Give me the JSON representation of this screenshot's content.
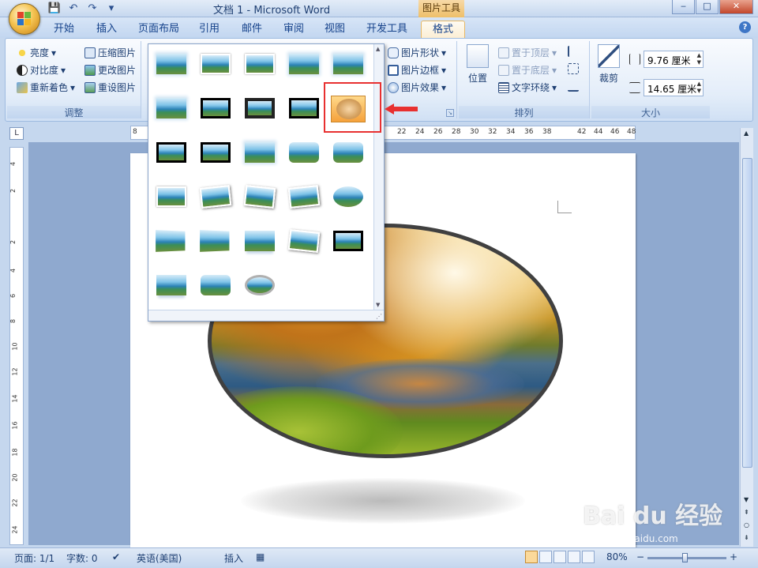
{
  "window": {
    "title": "文档 1 - Microsoft Word",
    "context_tab_group": "图片工具",
    "minimize": "‒",
    "maximize": "□",
    "close": "✕"
  },
  "tabs": [
    {
      "label": "开始"
    },
    {
      "label": "插入"
    },
    {
      "label": "页面布局"
    },
    {
      "label": "引用"
    },
    {
      "label": "邮件"
    },
    {
      "label": "审阅"
    },
    {
      "label": "视图"
    },
    {
      "label": "开发工具"
    },
    {
      "label": "格式",
      "active": true
    }
  ],
  "ribbon": {
    "adjust": {
      "label": "调整",
      "brightness": "亮度",
      "contrast": "对比度",
      "recolor": "重新着色",
      "compress": "压缩图片",
      "change": "更改图片",
      "reset": "重设图片"
    },
    "styles": {
      "shape": "图片形状",
      "border": "图片边框",
      "effects": "图片效果"
    },
    "arrange": {
      "label": "排列",
      "position": "位置",
      "bring_front": "置于顶层",
      "send_back": "置于底层",
      "text_wrap": "文字环绕"
    },
    "size": {
      "label": "大小",
      "crop": "裁剪",
      "height": "9.76 厘米",
      "width": "14.65 厘米"
    }
  },
  "ruler": {
    "h_ticks": [
      "8",
      "22",
      "24",
      "26",
      "28",
      "30",
      "32",
      "34",
      "36",
      "38",
      "42",
      "44",
      "46",
      "48"
    ],
    "v_ticks": [
      "4",
      "2",
      "2",
      "4",
      "6",
      "8",
      "10",
      "12",
      "14",
      "16",
      "18",
      "20",
      "22",
      "24"
    ],
    "corner": "L"
  },
  "gallery": {
    "selected_index": 9,
    "scroll_up": "▲",
    "scroll_down": "▼",
    "grip": "⋰"
  },
  "statusbar": {
    "page": "页面: 1/1",
    "words": "字数: 0",
    "language": "英语(美国)",
    "mode": "插入",
    "zoom": "80%",
    "zoom_out": "−",
    "zoom_in": "+"
  },
  "watermark": {
    "main": "Bai du 经验",
    "sub": "jingyan.baidu.com"
  },
  "colors": {
    "accent": "#15428b",
    "highlight": "#e83030",
    "active_tab": "#fbeed4"
  }
}
